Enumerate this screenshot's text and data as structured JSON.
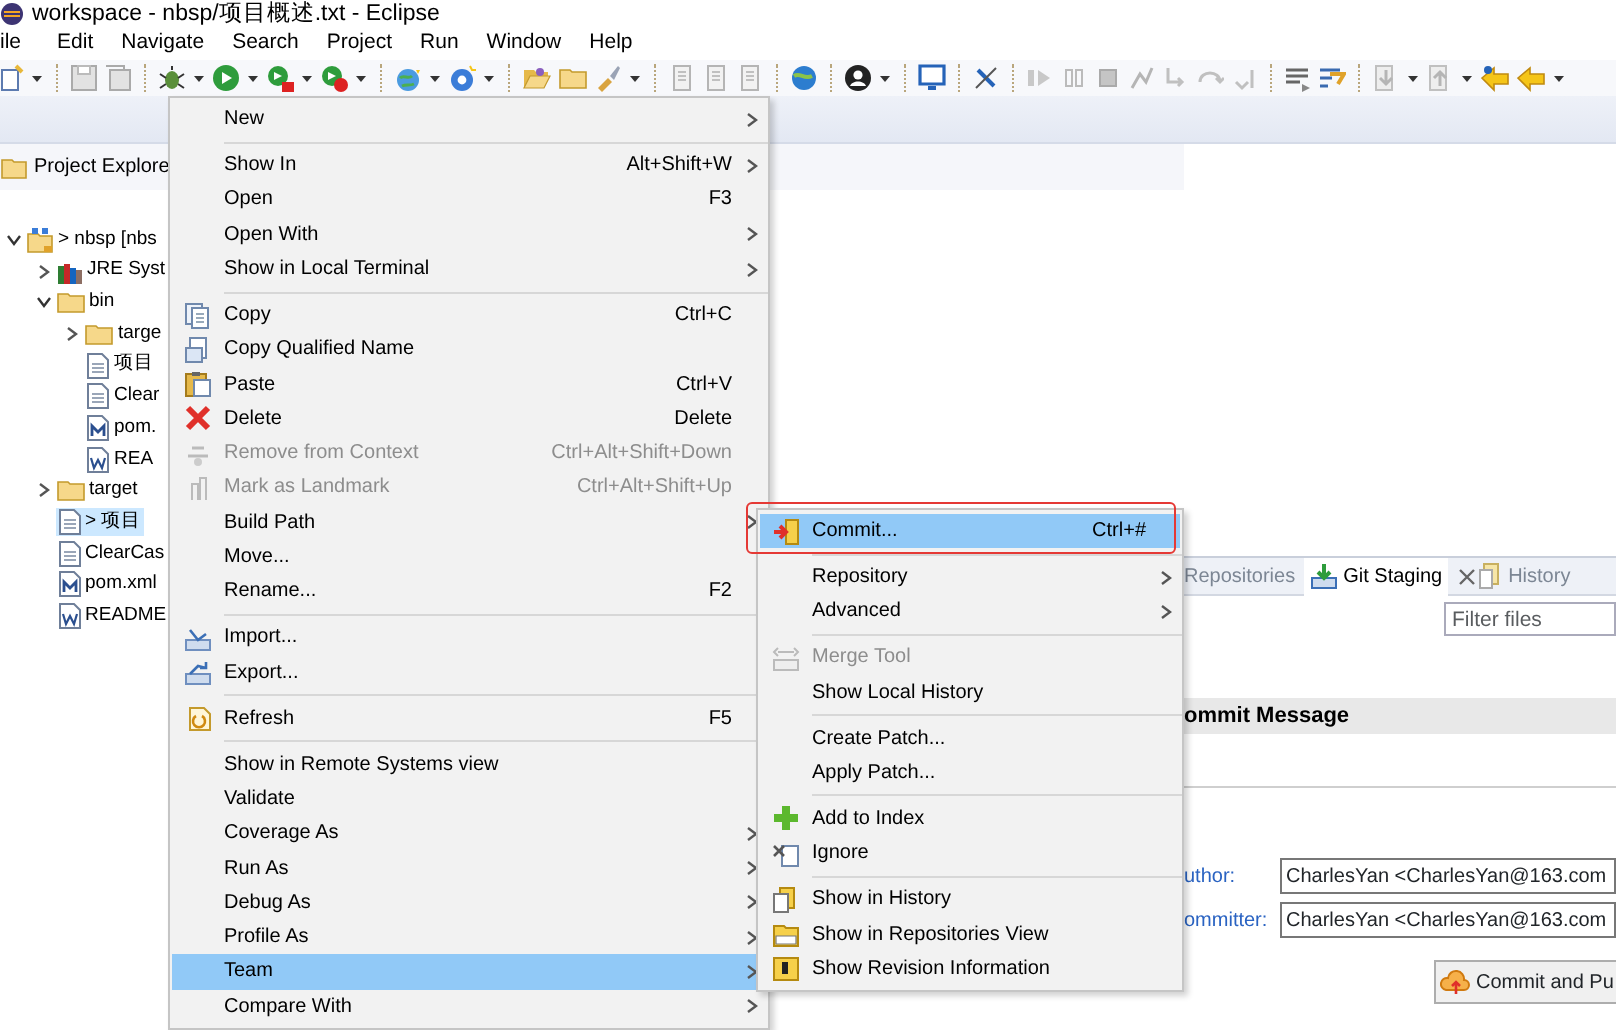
{
  "window": {
    "title": "workspace - nbsp/项目概述.txt - Eclipse"
  },
  "menu_bar": [
    {
      "label": "ile"
    },
    {
      "label": "Edit"
    },
    {
      "label": "Navigate"
    },
    {
      "label": "Search"
    },
    {
      "label": "Project"
    },
    {
      "label": "Run"
    },
    {
      "label": "Window"
    },
    {
      "label": "Help"
    }
  ],
  "project_explorer": {
    "title": "Project Explore",
    "tree": [
      {
        "label": "> nbsp [nbs",
        "kind": "project",
        "expanded": true,
        "selected": false,
        "children": [
          {
            "label": "JRE Syst",
            "kind": "library",
            "expanded": false,
            "selected": false
          },
          {
            "label": "bin",
            "kind": "folder",
            "expanded": true,
            "selected": false,
            "children": [
              {
                "label": "targe",
                "kind": "folder",
                "expanded": false,
                "selected": false
              },
              {
                "label": "项目",
                "kind": "file",
                "selected": false
              },
              {
                "label": "Clear",
                "kind": "file",
                "selected": false
              },
              {
                "label": "pom.",
                "kind": "pom",
                "selected": false
              },
              {
                "label": "REA",
                "kind": "doc",
                "selected": false
              }
            ]
          },
          {
            "label": "target",
            "kind": "folder",
            "expanded": false,
            "selected": false
          },
          {
            "label": "> 项目",
            "kind": "file",
            "selected": true
          },
          {
            "label": "ClearCas",
            "kind": "file",
            "selected": false
          },
          {
            "label": "pom.xml",
            "kind": "pom",
            "selected": false
          },
          {
            "label": "README",
            "kind": "doc",
            "selected": false
          }
        ]
      }
    ]
  },
  "context_menu": {
    "groups": [
      [
        {
          "label": "New",
          "submenu": true,
          "disabled": false,
          "selected": false
        }
      ],
      [
        {
          "label": "Show In",
          "shortcut": "Alt+Shift+W",
          "submenu": true,
          "disabled": false,
          "selected": false
        },
        {
          "label": "Open",
          "shortcut": "F3",
          "submenu": false,
          "disabled": false,
          "selected": false
        },
        {
          "label": "Open With",
          "submenu": true,
          "disabled": false,
          "selected": false
        },
        {
          "label": "Show in Local Terminal",
          "submenu": true,
          "disabled": false,
          "selected": false
        }
      ],
      [
        {
          "label": "Copy",
          "shortcut": "Ctrl+C",
          "submenu": false,
          "disabled": false,
          "selected": false
        },
        {
          "label": "Copy Qualified Name",
          "submenu": false,
          "disabled": false,
          "selected": false
        },
        {
          "label": "Paste",
          "shortcut": "Ctrl+V",
          "submenu": false,
          "disabled": false,
          "selected": false
        },
        {
          "label": "Delete",
          "shortcut": "Delete",
          "submenu": false,
          "disabled": false,
          "selected": false
        },
        {
          "label": "Remove from Context",
          "shortcut": "Ctrl+Alt+Shift+Down",
          "submenu": false,
          "disabled": true,
          "selected": false
        },
        {
          "label": "Mark as Landmark",
          "shortcut": "Ctrl+Alt+Shift+Up",
          "submenu": false,
          "disabled": true,
          "selected": false
        },
        {
          "label": "Build Path",
          "submenu": true,
          "disabled": false,
          "selected": false
        },
        {
          "label": "Move...",
          "submenu": false,
          "disabled": false,
          "selected": false
        },
        {
          "label": "Rename...",
          "shortcut": "F2",
          "submenu": false,
          "disabled": false,
          "selected": false
        }
      ],
      [
        {
          "label": "Import...",
          "submenu": false,
          "disabled": false,
          "selected": false
        },
        {
          "label": "Export...",
          "submenu": false,
          "disabled": false,
          "selected": false
        }
      ],
      [
        {
          "label": "Refresh",
          "shortcut": "F5",
          "submenu": false,
          "disabled": false,
          "selected": false
        }
      ],
      [
        {
          "label": "Show in Remote Systems view",
          "submenu": false,
          "disabled": false,
          "selected": false
        },
        {
          "label": "Validate",
          "submenu": false,
          "disabled": false,
          "selected": false
        },
        {
          "label": "Coverage As",
          "submenu": true,
          "disabled": false,
          "selected": false
        },
        {
          "label": "Run As",
          "submenu": true,
          "disabled": false,
          "selected": false
        },
        {
          "label": "Debug As",
          "submenu": true,
          "disabled": false,
          "selected": false
        },
        {
          "label": "Profile As",
          "submenu": true,
          "disabled": false,
          "selected": false
        },
        {
          "label": "Team",
          "submenu": true,
          "disabled": false,
          "selected": true
        },
        {
          "label": "Compare With",
          "submenu": true,
          "disabled": false,
          "selected": false
        }
      ]
    ]
  },
  "team_submenu": {
    "groups": [
      [
        {
          "label": "Commit...",
          "shortcut": "Ctrl+#",
          "submenu": false,
          "disabled": false,
          "selected": true
        }
      ],
      [
        {
          "label": "Repository",
          "submenu": true,
          "disabled": false,
          "selected": false
        },
        {
          "label": "Advanced",
          "submenu": true,
          "disabled": false,
          "selected": false
        }
      ],
      [
        {
          "label": "Merge Tool",
          "submenu": false,
          "disabled": true,
          "selected": false
        },
        {
          "label": "Show Local History",
          "submenu": false,
          "disabled": false,
          "selected": false
        }
      ],
      [
        {
          "label": "Create Patch...",
          "submenu": false,
          "disabled": false,
          "selected": false
        },
        {
          "label": "Apply Patch...",
          "submenu": false,
          "disabled": false,
          "selected": false
        }
      ],
      [
        {
          "label": "Add to Index",
          "submenu": false,
          "disabled": false,
          "selected": false
        },
        {
          "label": "Ignore",
          "submenu": false,
          "disabled": false,
          "selected": false
        }
      ],
      [
        {
          "label": "Show in History",
          "submenu": false,
          "disabled": false,
          "selected": false
        },
        {
          "label": "Show in Repositories View",
          "submenu": false,
          "disabled": false,
          "selected": false
        },
        {
          "label": "Show Revision Information",
          "submenu": false,
          "disabled": false,
          "selected": false
        }
      ]
    ]
  },
  "view_tabs": [
    {
      "label": "Repositories",
      "selected": false
    },
    {
      "label": "Git Staging",
      "selected": true
    },
    {
      "label": "History",
      "selected": false
    }
  ],
  "git_staging": {
    "filter": {
      "placeholder": "Filter files"
    },
    "commit_message_header": "ommit Message",
    "author": {
      "label": "uthor:",
      "value": "CharlesYan <CharlesYan@163.com"
    },
    "committer": {
      "label": "ommitter:",
      "value": "CharlesYan <CharlesYan@163.com"
    },
    "commit_button": "Commit and Pu"
  }
}
